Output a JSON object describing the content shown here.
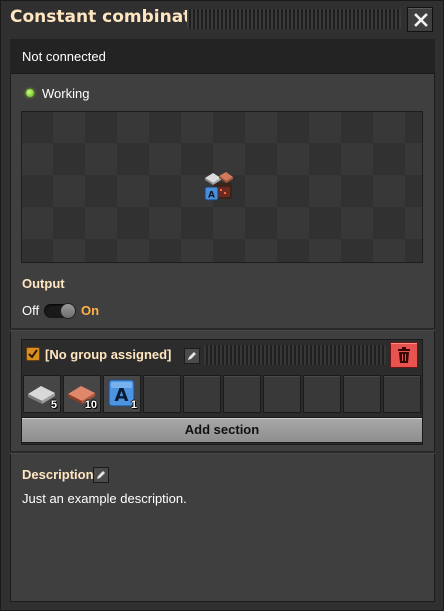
{
  "window": {
    "title": "Constant combinator"
  },
  "status": {
    "connection": "Not connected",
    "state": "Working"
  },
  "output": {
    "label": "Output",
    "off_label": "Off",
    "on_label": "On",
    "enabled": true
  },
  "group": {
    "checked": true,
    "name": "[No group assigned]",
    "signals": [
      {
        "icon": "iron-plate-icon",
        "count": "5"
      },
      {
        "icon": "copper-plate-icon",
        "count": "10"
      },
      {
        "icon": "signal-a-icon",
        "letter": "A",
        "count": "1"
      }
    ],
    "add_section_label": "Add section"
  },
  "description": {
    "label": "Description",
    "text": "Just an example description."
  },
  "colors": {
    "accent": "#ffb347",
    "heading": "#ffe6c0",
    "delete": "#e8524f",
    "working": "#7fd12a"
  }
}
